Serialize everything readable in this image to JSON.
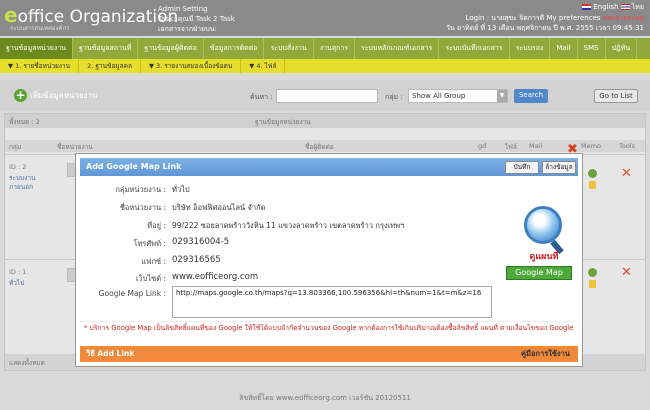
{
  "header": {
    "logo_brand": "office Organization",
    "logo_letter": "e",
    "logo_sub": "ระบบสารสนเทศองค์กร",
    "admin": "Admin Setting",
    "task": "Task: คุณมี Task 2 Task",
    "cabinet": "เอกสารจากฝ่ายบน:",
    "lang_en": "English",
    "lang_th": "ไทย",
    "login": "Login : นายสุขะ จิตการดี",
    "preferences": "My preferences",
    "logout": "ออกจากระบบ",
    "datetime": "วัน อาทิตย์ ที่ 13 เดือน พฤศจิกายน ปี พ.ศ. 2555 เวลา 09:45:31"
  },
  "nav": [
    "ฐานข้อมูลหน่วยงาน",
    "ฐานข้อมูลสถานที่",
    "ฐานข้อมูลผู้ติดต่อ",
    "ข้อมูลการติดต่อ",
    "ระบบสั่งงาน",
    "งานสุการ",
    "ระบบหลักเกณฑ์เอกสาร",
    "ระบบบันทึกเอกสาร",
    "ระบบรอง",
    "Mail",
    "SMS",
    "ปฏิทิน"
  ],
  "subnav": [
    "▼ 1. รายชื่อหน่วยงาน",
    "2. ฐานข้อมูลคล",
    "▼ 3. รายงานสมองเบื้องข้อตน",
    "▼ 4. ไฟล์"
  ],
  "toolbar": {
    "add_label": "เพิ่มข้อมูลหน่วยงาน",
    "search_label": "ค้นหา :",
    "search_value": "",
    "group_label": "กลุ่ม :",
    "group_selected": "Show All Group",
    "search_button": "Search",
    "goto_list": "Go to List"
  },
  "panel": {
    "count_label": "ทั้งหมด : 2",
    "list_title": "ฐานข้อมูลหน่วยงาน",
    "columns": [
      "กลุ่ม",
      "ชื่อหน่วยงาน",
      "ชื่อผู้ติดต่อ",
      "gd",
      "ไฟล์",
      "Mail",
      "Memo",
      "Tools"
    ],
    "rows": [
      {
        "id": "ID : 2",
        "group": "ระบบงาน",
        "sub": "ภายนอก"
      },
      {
        "id": "ID : 1",
        "group": "ทั่วไป",
        "sub": ""
      }
    ],
    "footer": "แสดงทั้งหมด",
    "copyright": "ลิขสิทธิ์โดย www.eofficeorg.com เวอร์ชัน 20120511"
  },
  "modal": {
    "title": "Add Google Map Link",
    "save_button": "บันทึก",
    "clear_button": "ล้างข้อมูล",
    "fields": [
      {
        "label": "กลุ่มหน่วยงาน :",
        "value": "ทั่วไป"
      },
      {
        "label": "ชื่อหน่วยงาน :",
        "value": "บริษัท อ็อฟฟิศออนไลน์ จำกัด"
      },
      {
        "label": "ที่อยู่ :",
        "value": "99/222 ซอยลาดพร้าววังหิน 11 แขวงลาดพร้าว เขตลาดพร้าว กรุงเทพฯ"
      },
      {
        "label": "โทรศัพท์ :",
        "value": "029316004-5"
      },
      {
        "label": "แฟกซ์ :",
        "value": "029316565"
      },
      {
        "label": "เว็บไซต์ :",
        "value": "www.eofficeorg.com"
      }
    ],
    "map_label": "Google Map Link :",
    "map_url": "http://maps.google.co.th/maps?q=13.803366,100.596356&hl=th&num=1&t=m&z=16",
    "map_view_label": "ดูแผนที่",
    "google_map_button": "Google Map",
    "note": "* บริการ Google Map เป็นลิขสิทธิ์แผนที่ของ Google ให้ใช้ได้แบบจำกัดจำนวนของ Google หากต้องการใช้เกินปริมาณต้องซื้อลิขสิทธิ์ แผนที่ ตามเงื่อนไขของ Google",
    "footer_left": "วิธี Add Link",
    "footer_right": "คู่มือการใช้งาน"
  },
  "colors": {
    "nav_green": "#8fa93a",
    "subnav_yellow": "#e5df2c",
    "modal_title_blue": "#5f97d5",
    "footer_orange": "#f08a3a",
    "google_map_green": "#4ea83a"
  }
}
